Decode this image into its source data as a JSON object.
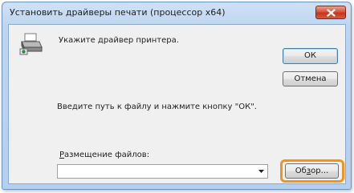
{
  "window": {
    "title": "Установить драйверы печати (процессор x64)"
  },
  "dialog": {
    "instruction": "Укажите драйвер принтера.",
    "prompt": "Введите путь к файлу и нажмите кнопку \"ОК\".",
    "location_label_underlined": "Р",
    "location_label_rest": "азмещение файлов:",
    "location_value": ""
  },
  "buttons": {
    "ok": "ОК",
    "cancel": "Отмена",
    "browse_pre": "Об",
    "browse_underlined": "з",
    "browse_post": "ор..."
  },
  "icons": {
    "printer": "printer-icon",
    "close": "close-icon",
    "dropdown": "chevron-down-icon"
  },
  "colors": {
    "highlight": "#f0941d",
    "close_button": "#d9533c"
  }
}
